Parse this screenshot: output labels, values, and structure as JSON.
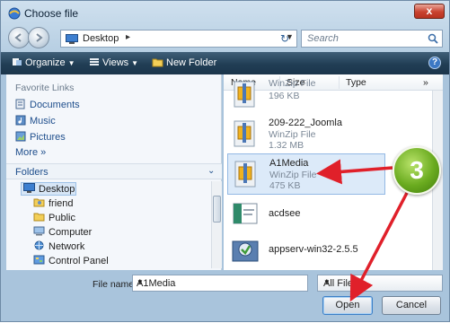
{
  "window": {
    "title": "Choose file",
    "close_label": "x"
  },
  "address": {
    "location": "Desktop",
    "chevron": "▸",
    "search_placeholder": "Search"
  },
  "toolbar": {
    "organize_label": "Organize",
    "views_label": "Views",
    "new_folder_label": "New Folder",
    "help_label": "?"
  },
  "nav": {
    "favorites_header": "Favorite Links",
    "favorites": [
      {
        "label": "Documents",
        "icon": "documents-icon"
      },
      {
        "label": "Music",
        "icon": "music-icon"
      },
      {
        "label": "Pictures",
        "icon": "pictures-icon"
      },
      {
        "label": "More »",
        "icon": ""
      }
    ],
    "folders_label": "Folders",
    "tree": [
      {
        "label": "Desktop",
        "icon": "desktop-icon"
      },
      {
        "label": "friend",
        "icon": "user-folder-icon"
      },
      {
        "label": "Public",
        "icon": "folder-icon"
      },
      {
        "label": "Computer",
        "icon": "computer-icon"
      },
      {
        "label": "Network",
        "icon": "network-icon"
      },
      {
        "label": "Control Panel",
        "icon": "control-panel-icon"
      }
    ]
  },
  "columns": {
    "name": "Name",
    "size": "Size",
    "type": "Type",
    "more": "»"
  },
  "files": [
    {
      "name": "",
      "type": "WinZip File",
      "size": "196 KB",
      "icon": "zip-file-icon"
    },
    {
      "name": "209-222_Joomla",
      "type": "WinZip File",
      "size": "1.32 MB",
      "icon": "zip-file-icon"
    },
    {
      "name": "A1Media",
      "type": "WinZip File",
      "size": "475 KB",
      "icon": "zip-file-icon"
    },
    {
      "name": "acdsee",
      "type": "",
      "size": "",
      "icon": "app-file-icon"
    },
    {
      "name": "appserv-win32-2.5.5",
      "type": "",
      "size": "",
      "icon": "installer-icon"
    }
  ],
  "footer": {
    "file_name_label": "File name:",
    "file_name_value": "A1Media",
    "filter_value": "All Files",
    "open_label": "Open",
    "cancel_label": "Cancel"
  },
  "annotation": {
    "step_number": "3",
    "color": "#e0202a"
  }
}
